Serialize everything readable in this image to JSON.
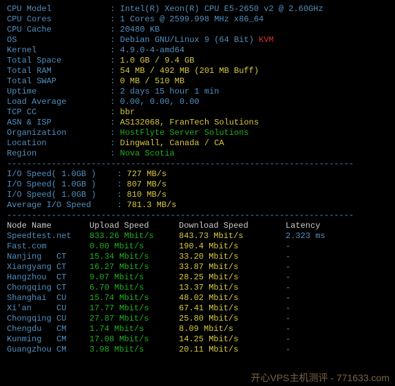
{
  "sys": [
    {
      "label": "CPU Model",
      "value": "Intel(R) Xeon(R) CPU E5-2650 v2 @ 2.60GHz",
      "color": "cyan"
    },
    {
      "label": "CPU Cores",
      "value": "1 Cores @ 2599.998 MHz x86_64",
      "color": "cyan"
    },
    {
      "label": "CPU Cache",
      "value": "20480 KB",
      "color": "cyan"
    },
    {
      "label": "OS",
      "value": "Debian GNU/Linux 9 (64 Bit)",
      "color": "cyan",
      "suffix": " KVM",
      "suffix_color": "red"
    },
    {
      "label": "Kernel",
      "value": "4.9.0-4-amd64",
      "color": "cyan"
    },
    {
      "label": "Total Space",
      "value": "1.0 GB / 9.4 GB",
      "color": "yellow"
    },
    {
      "label": "Total RAM",
      "value": "54 MB / 492 MB (201 MB Buff)",
      "color": "yellow"
    },
    {
      "label": "Total SWAP",
      "value": "0 MB / 510 MB",
      "color": "yellow"
    },
    {
      "label": "Uptime",
      "value": "2 days 15 hour 1 min",
      "color": "cyan"
    },
    {
      "label": "Load Average",
      "value": "0.00, 0.00, 0.00",
      "color": "cyan"
    },
    {
      "label": "TCP CC",
      "value": "bbr",
      "color": "yellow"
    },
    {
      "label": "ASN & ISP",
      "value": "AS132068, FranTech Solutions",
      "color": "yellow"
    },
    {
      "label": "Organization",
      "value": "HostFlyte Server Solutions",
      "color": "green"
    },
    {
      "label": "Location",
      "value": "Dingwall, Canada / CA",
      "color": "yellow"
    },
    {
      "label": "Region",
      "value": "Nova Scotia",
      "color": "green"
    }
  ],
  "io": [
    {
      "label": "I/O Speed( 1.0GB )",
      "value": "727 MB/s"
    },
    {
      "label": "I/O Speed( 1.0GB )",
      "value": "807 MB/s"
    },
    {
      "label": "I/O Speed( 1.0GB )",
      "value": "810 MB/s"
    },
    {
      "label": "Average I/O Speed",
      "value": "781.3 MB/s"
    }
  ],
  "sp_header": {
    "c1": "Node Name",
    "c2": "Upload Speed",
    "c3": "Download Speed",
    "c4": "Latency"
  },
  "sp": [
    {
      "node": "Speedtest.net",
      "up": "833.26 Mbit/s",
      "down": "843.73 Mbit/s",
      "lat": "2.323 ms"
    },
    {
      "node": "Fast.com",
      "up": "0.00 Mbit/s",
      "down": "190.4 Mbit/s",
      "lat": "-"
    },
    {
      "node": "Nanjing   CT",
      "up": "15.34 Mbit/s",
      "down": "33.20 Mbit/s",
      "lat": "-"
    },
    {
      "node": "Xiangyang CT",
      "up": "16.27 Mbit/s",
      "down": "33.87 Mbit/s",
      "lat": "-"
    },
    {
      "node": "Hangzhou  CT",
      "up": "9.07 Mbit/s",
      "down": "28.25 Mbit/s",
      "lat": "-"
    },
    {
      "node": "Chongqing CT",
      "up": "6.70 Mbit/s",
      "down": "13.37 Mbit/s",
      "lat": "-"
    },
    {
      "node": "Shanghai  CU",
      "up": "15.74 Mbit/s",
      "down": "48.02 Mbit/s",
      "lat": "-"
    },
    {
      "node": "Xi'an     CU",
      "up": "17.77 Mbit/s",
      "down": "67.41 Mbit/s",
      "lat": "-"
    },
    {
      "node": "Chongqing CU",
      "up": "27.87 Mbit/s",
      "down": "25.80 Mbit/s",
      "lat": "-"
    },
    {
      "node": "Chengdu   CM",
      "up": "1.74 Mbit/s",
      "down": "8.09 Mbit/s",
      "lat": "-"
    },
    {
      "node": "Kunming   CM",
      "up": "17.08 Mbit/s",
      "down": "14.25 Mbit/s",
      "lat": "-"
    },
    {
      "node": "Guangzhou CM",
      "up": "3.98 Mbit/s",
      "down": "20.11 Mbit/s",
      "lat": "-"
    }
  ],
  "watermark": "开心VPS主机测评 - 771633.com",
  "divider": "----------------------------------------------------------------------"
}
